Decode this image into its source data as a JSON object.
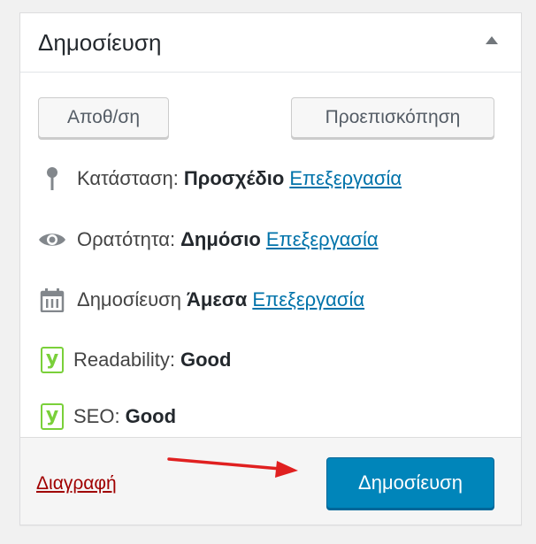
{
  "panel": {
    "title": "Δημοσίευση"
  },
  "actions": {
    "save_label": "Αποθ/ση",
    "preview_label": "Προεπισκόπηση"
  },
  "status": {
    "label": "Κατάσταση:",
    "value": "Προσχέδιο",
    "edit": "Επεξεργασία"
  },
  "visibility": {
    "label": "Ορατότητα:",
    "value": "Δημόσιο",
    "edit": "Επεξεργασία"
  },
  "schedule": {
    "label": "Δημοσίευση",
    "value": "Άμεσα",
    "edit": "Επεξεργασία"
  },
  "readability": {
    "label": "Readability:",
    "value": "Good"
  },
  "seo": {
    "label": "SEO:",
    "value": "Good"
  },
  "footer": {
    "delete_label": "Διαγραφή",
    "publish_label": "Δημοσίευση"
  },
  "icons": {
    "status": "pin-icon",
    "visibility": "eye-icon",
    "schedule": "calendar-icon",
    "readability": "yoast-icon",
    "seo": "yoast-icon",
    "toggle": "triangle-up-icon"
  },
  "colors": {
    "link": "#0073aa",
    "delete": "#a00000",
    "primary": "#0085ba",
    "yoast_good": "#7ad03a",
    "arrow": "#e02020"
  }
}
